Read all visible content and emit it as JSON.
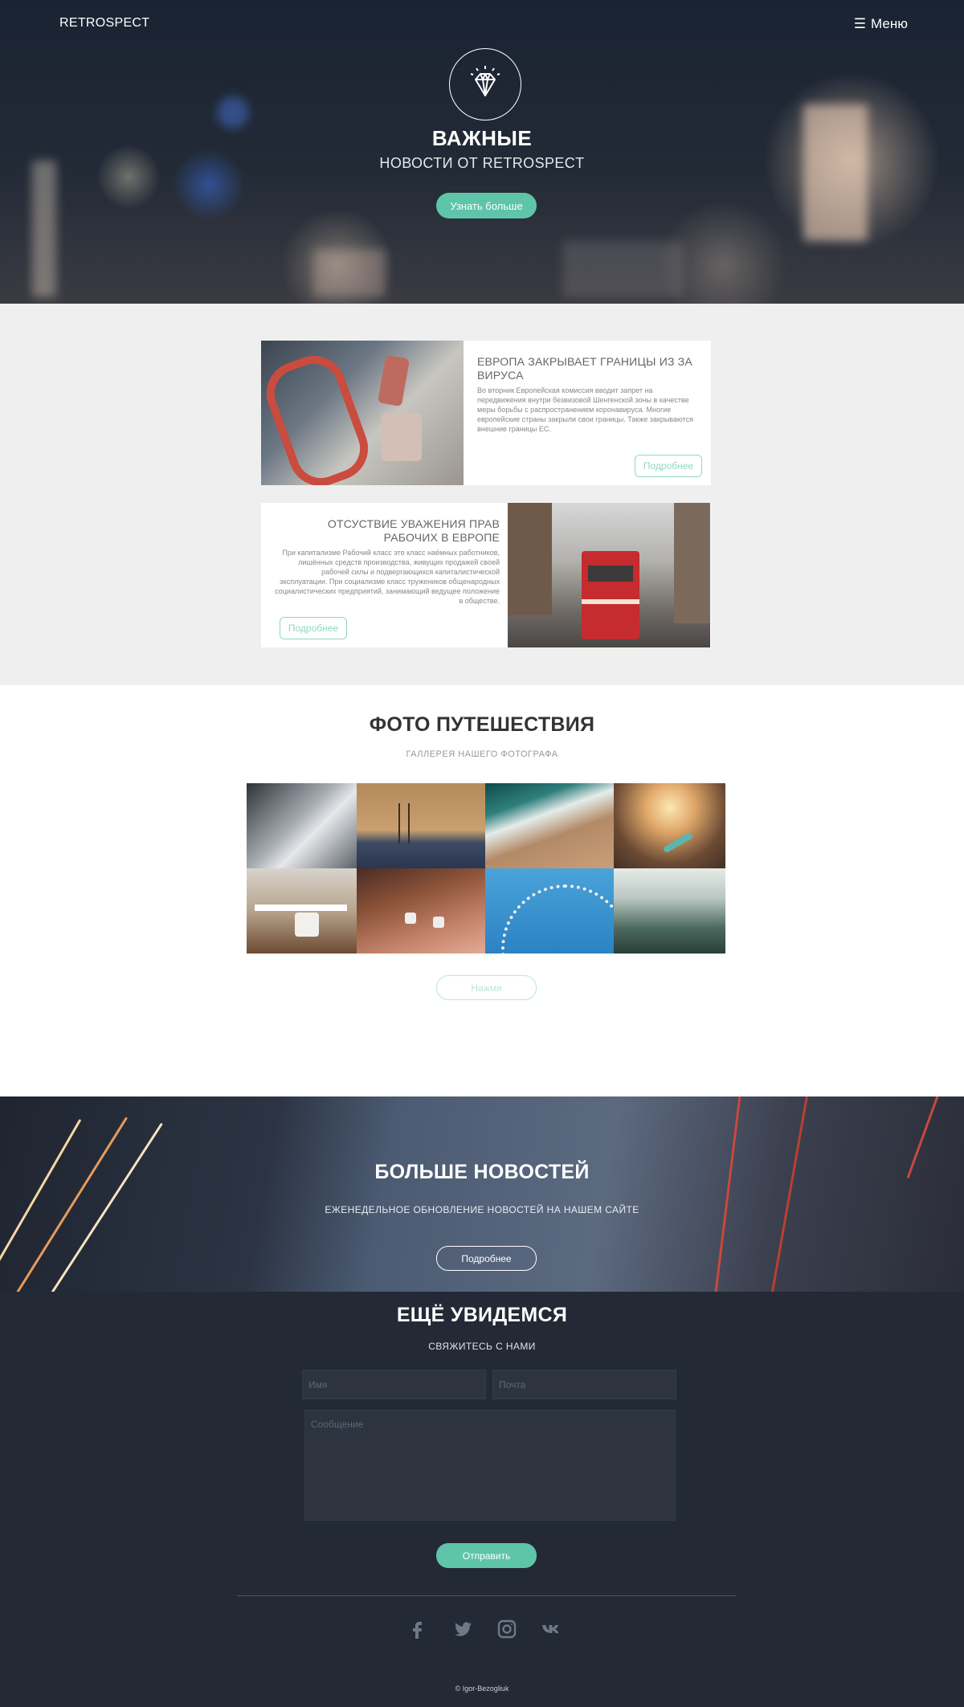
{
  "hero": {
    "brand": "RETROSPECT",
    "menu_icon": "☰",
    "menu_label": "Меню",
    "title": "ВАЖНЫЕ",
    "subtitle": "НОВОСТИ ОТ RETROSPECT",
    "button_label": "Узнать больше",
    "logo_icon": "diamond-icon"
  },
  "news": {
    "items": [
      {
        "title": "ЕВРОПА ЗАКРЫВАЕТ ГРАНИЦЫ ИЗ ЗА ВИРУСА",
        "body": "Во вторник Европейская комиссия вводит запрет на передвижения внутри безвизовой Шенгенской зоны в качестве меры борьбы с распространением коронавируса. Многие европейские страны закрыли свои границы. Также закрываются внешние границы ЕС.",
        "button": "Подробнее"
      },
      {
        "title": "ОТСУСТВИЕ УВАЖЕНИЯ ПРАВ РАБОЧИХ В ЕВРОПЕ",
        "body": "При капитализме Рабочий класс это класс наёмных работников, лишённых средств производства, живущих продажей своей рабочей силы и подвергающихся капиталистической эксплуатации. При социализме класс тружеников общенародных социалистических предприятий, занимающий ведущее положение в обществе.",
        "button": "Подробнее"
      }
    ]
  },
  "gallery": {
    "title": "ФОТО ПУТЕШЕСТВИЯ",
    "subtitle": "ГАЛЛЕРЕЯ НАШЕГО ФОТОГРАФА",
    "button": "Нажми"
  },
  "more_news": {
    "title": "БОЛЬШЕ НОВОСТЕЙ",
    "subtitle": "ЕЖЕНЕДЕЛЬНОЕ ОБНОВЛЕНИЕ НОВОСТЕЙ НА НАШЕМ САЙТЕ",
    "button": "Подробнее"
  },
  "contact": {
    "title": "ЕЩЁ УВИДЕМСЯ",
    "subtitle": "СВЯЖИТЕСЬ С НАМИ",
    "name_placeholder": "Имя",
    "email_placeholder": "Почта",
    "message_placeholder": "Сообщение",
    "send_button": "Отправить",
    "socials": [
      "facebook-icon",
      "twitter-icon",
      "instagram-icon",
      "vk-icon"
    ],
    "copyright": "© Igor-Bezogliuk"
  },
  "colors": {
    "accent": "#5ec4aa",
    "dark_bg": "#232a35",
    "news_bg": "#efefef"
  }
}
